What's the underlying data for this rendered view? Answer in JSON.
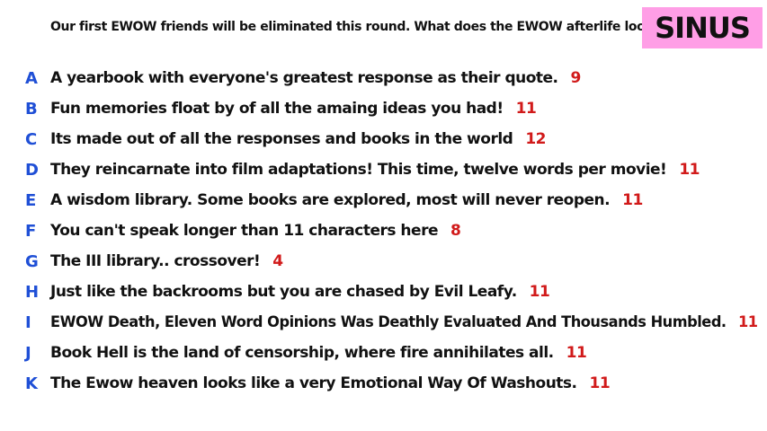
{
  "prompt": "Our first EWOW friends will be eliminated this round. What does the EWOW afterlife look like?",
  "title": "SINUS",
  "colors": {
    "title_bg": "#ff9ee6",
    "letter": "#1f4fd6",
    "count": "#d11a1a",
    "text": "#111111"
  },
  "responses": [
    {
      "letter": "A",
      "text": "A yearbook with everyone's greatest response as their quote.",
      "count": "9"
    },
    {
      "letter": "B",
      "text": "Fun memories float by of all the amaing ideas you had!",
      "count": "11"
    },
    {
      "letter": "C",
      "text": "Its made out of all the responses and books in the world",
      "count": "12"
    },
    {
      "letter": "D",
      "text": "They reincarnate into film adaptations! This time, twelve words per movie!",
      "count": "11"
    },
    {
      "letter": "E",
      "text": "A wisdom library. Some books are explored, most will never reopen.",
      "count": "11"
    },
    {
      "letter": "F",
      "text": "You can't speak longer than 11 characters here",
      "count": "8"
    },
    {
      "letter": "G",
      "text": "The III library.. crossover!",
      "count": "4"
    },
    {
      "letter": "H",
      "text": "Just like the backrooms but you are chased by Evil Leafy.",
      "count": "11"
    },
    {
      "letter": "I",
      "text": "EWOW Death, Eleven Word Opinions Was Deathly Evaluated And Thousands Humbled.",
      "count": "11"
    },
    {
      "letter": "J",
      "text": "Book Hell is the land of censorship, where fire annihilates all.",
      "count": "11"
    },
    {
      "letter": "K",
      "text": "The Ewow heaven looks like a very Emotional Way Of Washouts.",
      "count": "11"
    }
  ]
}
